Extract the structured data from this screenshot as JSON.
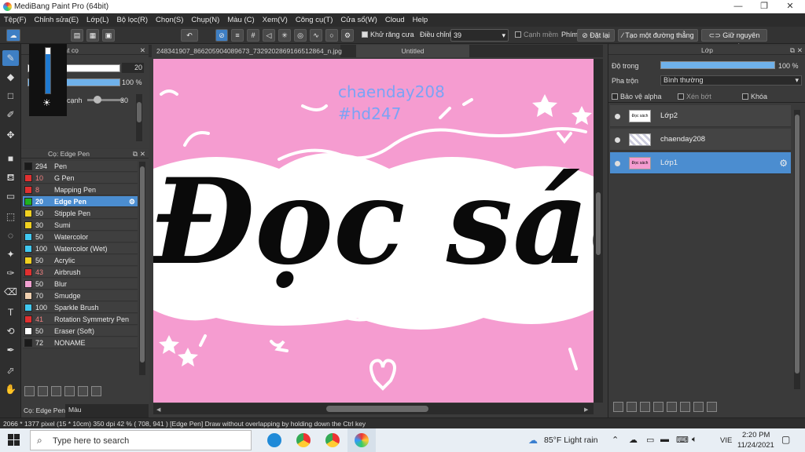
{
  "window": {
    "title": "MediBang Paint Pro (64bit)",
    "controls": [
      "—",
      "❐",
      "✕"
    ]
  },
  "menu": [
    "Tệp(F)",
    "Chỉnh sửa(E)",
    "Lớp(L)",
    "Bộ lọc(R)",
    "Chọn(S)",
    "Chụp(N)",
    "Màu (C)",
    "Xem(V)",
    "Công cụ(T)",
    "Cửa sổ(W)",
    "Cloud",
    "Help"
  ],
  "toolbar": {
    "antialias_label": "Khử răng cưa",
    "adjust_label": "Điều chỉnh",
    "adjust_value": "39",
    "soft_edge_label": "Cạnh mềm",
    "key_label": "Phím",
    "reset_label": "Đặt lại",
    "line_label": "Tạo một đường thẳng",
    "keep_edge_label": "Giữ nguyên cạnh"
  },
  "brush_control": {
    "title": "m soát cọ",
    "size_value": "20",
    "opacity_value": "100 %",
    "edge_label": "cạnh",
    "edge_value": "30"
  },
  "brush_panel": {
    "title": "Cọ: Edge Pen",
    "brushes": [
      {
        "size": "294",
        "name": "Pen",
        "color": "#1a1a1a"
      },
      {
        "size": "10",
        "name": "G Pen",
        "color": "#e03030"
      },
      {
        "size": "8",
        "name": "Mapping Pen",
        "color": "#e03030"
      },
      {
        "size": "20",
        "name": "Edge Pen",
        "color": "#20b020"
      },
      {
        "size": "50",
        "name": "Stipple Pen",
        "color": "#f0d020"
      },
      {
        "size": "30",
        "name": "Sumi",
        "color": "#f0d020"
      },
      {
        "size": "50",
        "name": "Watercolor",
        "color": "#40c8f0"
      },
      {
        "size": "100",
        "name": "Watercolor (Wet)",
        "color": "#40c8f0"
      },
      {
        "size": "50",
        "name": "Acrylic",
        "color": "#f0d020"
      },
      {
        "size": "43",
        "name": "Airbrush",
        "color": "#e03030"
      },
      {
        "size": "50",
        "name": "Blur",
        "color": "#f0a0d0"
      },
      {
        "size": "70",
        "name": "Smudge",
        "color": "#f0d0b0"
      },
      {
        "size": "100",
        "name": "Sparkle Brush",
        "color": "#40c8f0"
      },
      {
        "size": "41",
        "name": "Rotation Symmetry Pen",
        "color": "#e03030"
      },
      {
        "size": "50",
        "name": "Eraser (Soft)",
        "color": "#ffffff"
      },
      {
        "size": "72",
        "name": "NONAME",
        "color": "#1a1a1a"
      }
    ],
    "bottom_tabs": [
      "Cọ: Edge Pen",
      "Màu"
    ]
  },
  "tabs": {
    "file": "248341907_866205904089673_7329202869166512864_n.jpg",
    "untitled": "Untitled"
  },
  "canvas": {
    "text1": "chaenday208",
    "text2": "#hd247",
    "art": "Đọc sách"
  },
  "layer_panel": {
    "title": "Lớp",
    "opacity_label": "Độ trong",
    "opacity_value": "100 %",
    "blend_label": "Pha trộn",
    "blend_value": "Bình thường",
    "protect_alpha": "Bảo vệ alpha",
    "clip": "Xén bớt",
    "lock": "Khóa",
    "layers": [
      {
        "name": "Lớp2",
        "thumb": "Đọc sách"
      },
      {
        "name": "chaenday208",
        "thumb": ""
      },
      {
        "name": "Lớp1",
        "thumb": "Đọc sách"
      }
    ]
  },
  "status": "2066 * 1377 pixel   (15 * 10cm)   350 dpi   42 %   ( 708, 941 )   [Edge Pen] Draw without overlapping by holding down the Ctrl key",
  "taskbar": {
    "search": "Type here to search",
    "weather": "85°F  Light rain",
    "lang": "VIE",
    "time": "2:20 PM",
    "date": "11/24/2021"
  }
}
